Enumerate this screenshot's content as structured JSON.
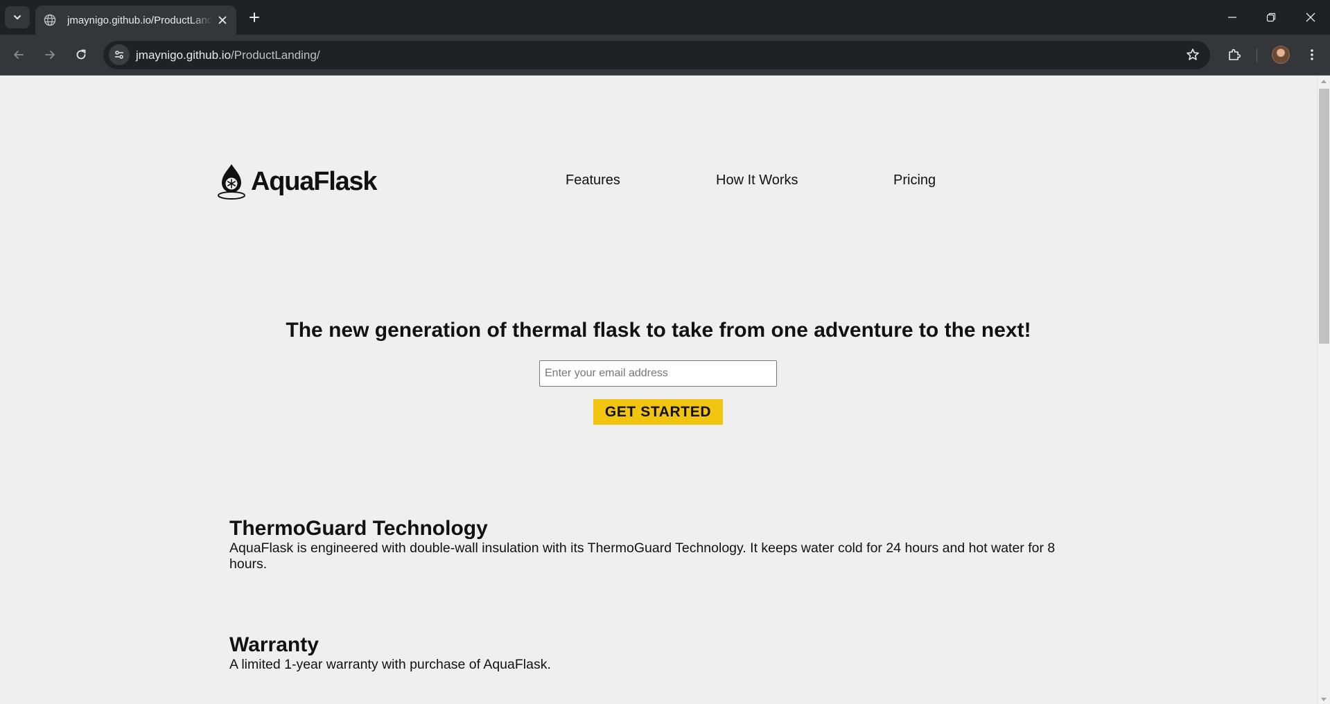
{
  "browser": {
    "tab_title": "jmaynigo.github.io/ProductLanding/",
    "url_host": "jmaynigo.github.io",
    "url_path": "/ProductLanding/"
  },
  "page": {
    "logo_text": "AquaFlask",
    "nav": [
      {
        "label": "Features"
      },
      {
        "label": "How It Works"
      },
      {
        "label": "Pricing"
      }
    ],
    "hero": {
      "title": "The new generation of thermal flask to take from one adventure to the next!",
      "email_placeholder": "Enter your email address",
      "cta_label": "GET STARTED"
    },
    "features": [
      {
        "title": "ThermoGuard Technology",
        "text": "AquaFlask is engineered with double-wall insulation with its ThermoGuard Technology. It keeps water cold for 24 hours and hot water for 8 hours."
      },
      {
        "title": "Warranty",
        "text": "A limited 1-year warranty with purchase of AquaFlask."
      }
    ]
  },
  "colors": {
    "page_bg": "#efefef",
    "cta_bg": "#f1c40f",
    "chrome_dark": "#202124",
    "chrome_toolbar": "#35363a"
  }
}
